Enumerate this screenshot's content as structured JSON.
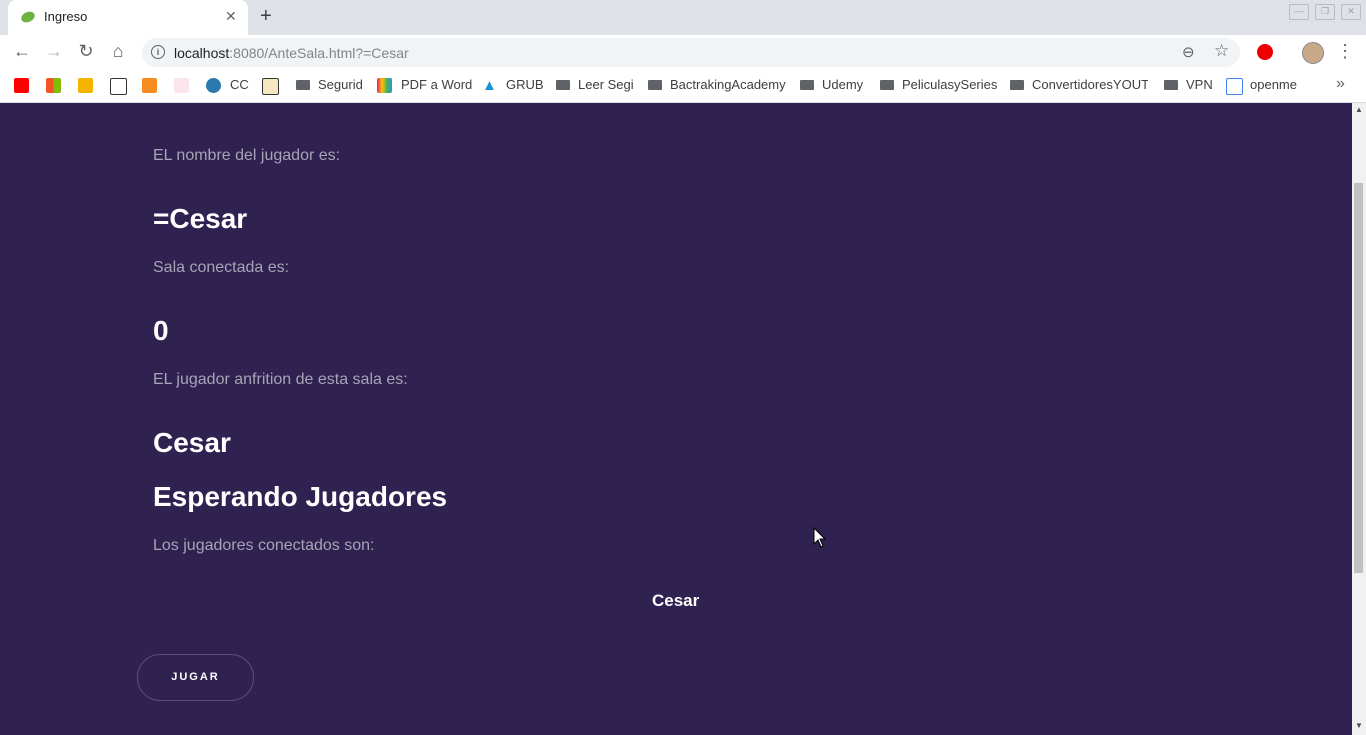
{
  "tab": {
    "title": "Ingreso",
    "close": "✕",
    "new_tab": "+"
  },
  "window_controls": {
    "minimize": "—",
    "restore": "❐",
    "close": "✕"
  },
  "toolbar": {
    "back": "←",
    "forward": "→",
    "reload": "↻",
    "home": "⌂",
    "url_host": "localhost",
    "url_rest": ":8080/AnteSala.html?=Cesar",
    "zoom": "⊖",
    "star": "☆",
    "menu": "⋮"
  },
  "bookmarks": {
    "items": [
      {
        "label": "CC"
      },
      {
        "label": "Segurid"
      },
      {
        "label": "PDF a Word"
      },
      {
        "label": "GRUB"
      },
      {
        "label": "Leer Segi"
      },
      {
        "label": "BactrakingAcademy"
      },
      {
        "label": "Udemy"
      },
      {
        "label": "PeliculasySeries"
      },
      {
        "label": "ConvertidoresYOUT"
      },
      {
        "label": "VPN"
      },
      {
        "label": "openme"
      }
    ],
    "more": "»"
  },
  "page": {
    "player_name_label": "EL nombre del jugador es:",
    "player_name": "=Cesar",
    "room_label": "Sala conectada es:",
    "room_value": "0",
    "host_label": "EL jugador anfrition de esta sala es:",
    "host_value": "Cesar",
    "waiting_title": "Esperando Jugadores",
    "connected_label": "Los jugadores conectados son:",
    "connected_players": [
      "Cesar"
    ],
    "play_button": "JUGAR"
  },
  "colors": {
    "page_bg": "#2f2150",
    "label": "#a8a3b5",
    "text": "#ffffff"
  }
}
